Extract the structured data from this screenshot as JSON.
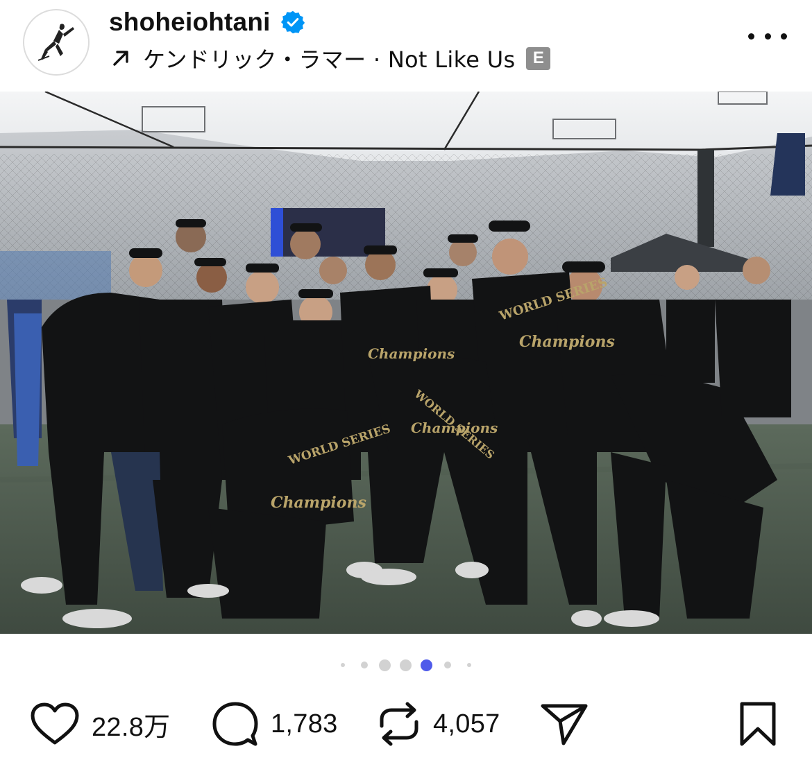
{
  "post": {
    "username": "shoheiohtani",
    "audio": "ケンドリック・ラマー · Not Like Us",
    "explicit_badge": "E"
  },
  "carousel": {
    "total_dots": 7,
    "active_index": 4
  },
  "photo": {
    "shirt_line1": "WORLD SERIES",
    "shirt_line2": "Champions"
  },
  "actions": {
    "likes": "22.8万",
    "comments": "1,783",
    "reposts": "4,057"
  },
  "icons": {
    "verified": "verified-badge-icon",
    "audio_arrow": "arrow-up-right-icon",
    "more": "more-horizontal-icon",
    "mute": "speaker-muted-icon",
    "like": "heart-icon",
    "comment": "comment-bubble-icon",
    "repost": "repost-icon",
    "share": "paper-plane-icon",
    "save": "bookmark-icon"
  },
  "colors": {
    "verified_blue": "#0095f6",
    "active_dot": "#4f5bea",
    "inactive_dot": "#d2d2d2"
  }
}
